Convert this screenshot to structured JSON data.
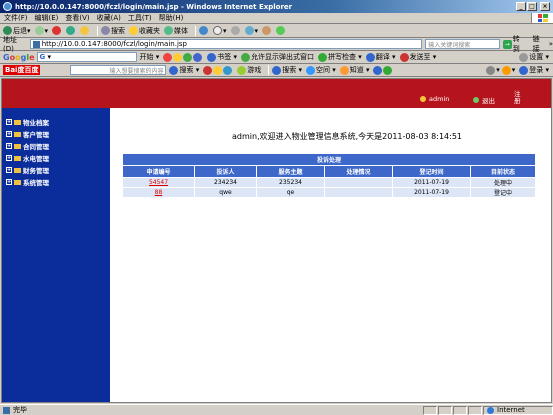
{
  "window": {
    "title": "http://10.0.0.147:8000/fczl/login/main.jsp - Windows Internet Explorer"
  },
  "menu": [
    "文件(F)",
    "编辑(E)",
    "查看(V)",
    "收藏(A)",
    "工具(T)",
    "帮助(H)"
  ],
  "toolbar": {
    "back": "后退",
    "search": "搜索",
    "favorites": "收藏夹",
    "media": "媒体"
  },
  "address": {
    "label": "地址(D)",
    "url": "http://10.0.0.147:8000/fczl/login/main.jsp",
    "keyword_placeholder": "输入关键词搜索",
    "go": "转到",
    "links": "链接"
  },
  "google": {
    "logo": "Google",
    "start": "开始",
    "bookmarks": "书签",
    "popups": "允许显示弹出式窗口",
    "spellcheck": "拼写检查",
    "translate": "翻译",
    "sendto": "发送至",
    "settings": "设置"
  },
  "baidu": {
    "logo": "Bai度百度",
    "placeholder": "输入想要搜索的内容",
    "search": "搜索",
    "games": "游戏",
    "space": "空间",
    "knowledge": "知道",
    "login": "登录"
  },
  "header": {
    "user": "admin",
    "logout": "退出",
    "register": "注册"
  },
  "sidebar": {
    "items": [
      {
        "label": "物业档案"
      },
      {
        "label": "客户管理"
      },
      {
        "label": "合同管理"
      },
      {
        "label": "水电管理"
      },
      {
        "label": "财务管理"
      },
      {
        "label": "系统管理"
      }
    ]
  },
  "welcome": "admin,欢迎进入物业管理信息系统,今天是2011-08-03 8:14:51",
  "complaints": {
    "caption": "投诉处理",
    "columns": [
      "申请编号",
      "投诉人",
      "服务主题",
      "处理情况",
      "登记时间",
      "目前状态"
    ],
    "rows": [
      {
        "id": "54547",
        "complainant": "234234",
        "subject": "235234",
        "handling": "",
        "date": "2011-07-19",
        "status": "处理中"
      },
      {
        "id": "88",
        "complainant": "qwe",
        "subject": "qe",
        "handling": "",
        "date": "2011-07-19",
        "status": "登记中"
      }
    ]
  },
  "status": {
    "text": "完毕",
    "zone": "Internet"
  },
  "colors": {
    "header_red": "#b5141c",
    "sidebar_blue": "#0b2d9c",
    "table_header": "#3d68c9",
    "table_row": "#dde6f6"
  }
}
